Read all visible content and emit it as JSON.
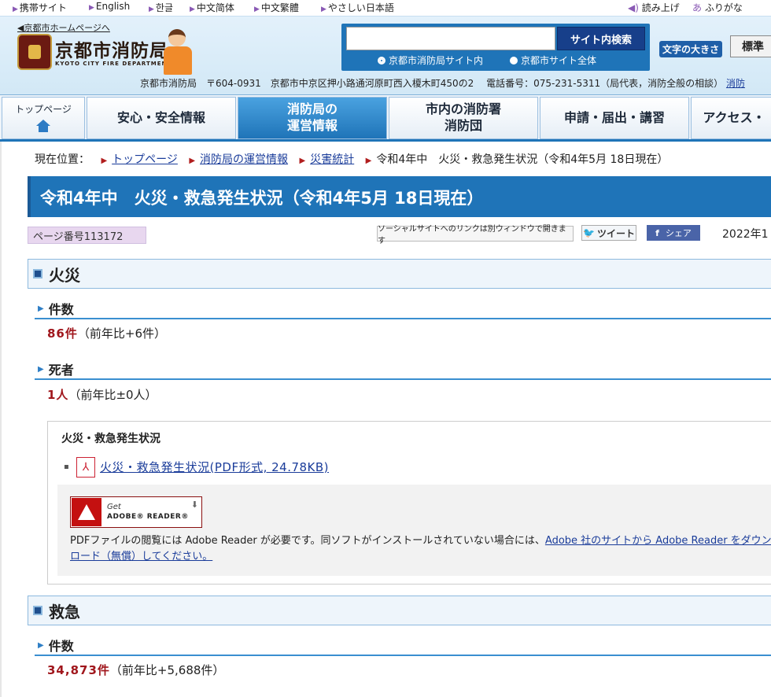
{
  "utility": {
    "languages": [
      {
        "label": "携帯サイト",
        "left": 0
      },
      {
        "label": "English"
      },
      {
        "label": "한글"
      },
      {
        "label": "中文简体"
      },
      {
        "label": "中文繁體"
      },
      {
        "label": "やさしい日本語"
      }
    ],
    "read_aloud": "読み上げ",
    "furigana": "ふりがな"
  },
  "header": {
    "home_link": "◀京都市ホームページへ",
    "logo_title": "京都市消防局",
    "logo_sub": "KYOTO CITY FIRE DEPARTMENT",
    "search_placeholder": "",
    "search_button": "サイト内検索",
    "search_opt_1": "京都市消防局サイト内",
    "search_opt_2": "京都市サイト全体",
    "font_size_label": "文字の大きさ",
    "font_size_std": "標準",
    "address": "京都市消防局　〒604-0931　京都市中京区押小路通河原町西入榎木町450の2　 電話番号：075-231-5311（局代表，消防全般の相談）",
    "address_link": "消防"
  },
  "nav": {
    "top": "トップページ",
    "items": [
      "安心・安全情報",
      "消防局の\n運営情報",
      "市内の消防署\n消防団",
      "申請・届出・講習",
      "アクセス・"
    ]
  },
  "breadcrumb": {
    "label": "現在位置：",
    "links": [
      "トップページ",
      "消防局の運営情報",
      "災害統計"
    ],
    "current": "令和4年中　火災・救急発生状況（令和4年5月 18日現在）"
  },
  "page_title": "令和4年中　火災・救急発生状況（令和4年5月 18日現在）",
  "page_number": "ページ番号113172",
  "social": {
    "note": "ソーシャルサイトへのリンクは別ウィンドウで開きます",
    "tweet": "ツイート",
    "share": "シェア"
  },
  "update_date": "2022年1",
  "fire": {
    "heading": "火災",
    "count_heading": "件数",
    "count_value": "86件",
    "count_note": "（前年比+6件）",
    "death_heading": "死者",
    "death_value": "1人",
    "death_note": "（前年比±0人）"
  },
  "document": {
    "title": "火災・救急発生状況",
    "bullet": "▪",
    "link": "火災・救急発生状況(PDF形式, 24.78KB)",
    "reader_get": "Get",
    "reader_name": "ADOBE® READER®",
    "reader_text": "PDFファイルの閲覧には Adobe Reader が必要です。同ソフトがインストールされていない場合には、",
    "reader_link": "Adobe 社のサイトから Adobe Reader をダウンロード（無償）してください。"
  },
  "ems": {
    "heading": "救急",
    "count_heading": "件数",
    "count_value": "34,873件",
    "count_note": "（前年比+5,688件）"
  }
}
